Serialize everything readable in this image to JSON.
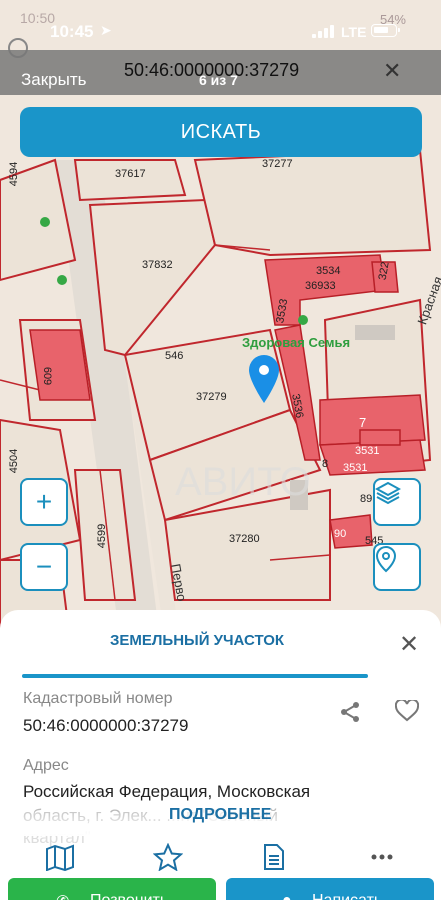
{
  "status": {
    "time": "10:45",
    "network": "LTE",
    "ghost_time": "10:50",
    "ghost_battery": "54%"
  },
  "header": {
    "close_label": "Закрыть",
    "title": "50:46:0000000:37279",
    "counter": "6 из 7"
  },
  "search": {
    "label": "ИСКАТЬ"
  },
  "map": {
    "parcels": [
      "37277",
      "37617",
      "37832",
      "36933",
      "3534",
      "322",
      "3533",
      "546",
      "37279",
      "3536",
      "7",
      "3531",
      "8",
      "3531",
      "89",
      "90",
      "545",
      "37280",
      "4594",
      "609",
      "4504",
      "4599"
    ],
    "streets": [
      "Красная",
      "Перво"
    ],
    "poi": "Здоровая Семья"
  },
  "sheet": {
    "title": "ЗЕМЕЛЬНЫЙ УЧАСТОК",
    "cad_label": "Кадастровый номер",
    "cad_value": "50:46:0000000:37279",
    "addr_label": "Адрес",
    "addr_line1": "Российская Федерация, Московская",
    "addr_line2": "область, г. Элек... ...нт \"Зеленый",
    "addr_line3": "квартал\"",
    "more_label": "ПОДРОБНЕЕ"
  },
  "actions": {
    "call": "Позвонить",
    "write": "Написать"
  },
  "colors": {
    "accent": "#1a95c9",
    "call": "#2ab44a",
    "parcel_fill": "#e8636b",
    "border": "#c0272d"
  }
}
